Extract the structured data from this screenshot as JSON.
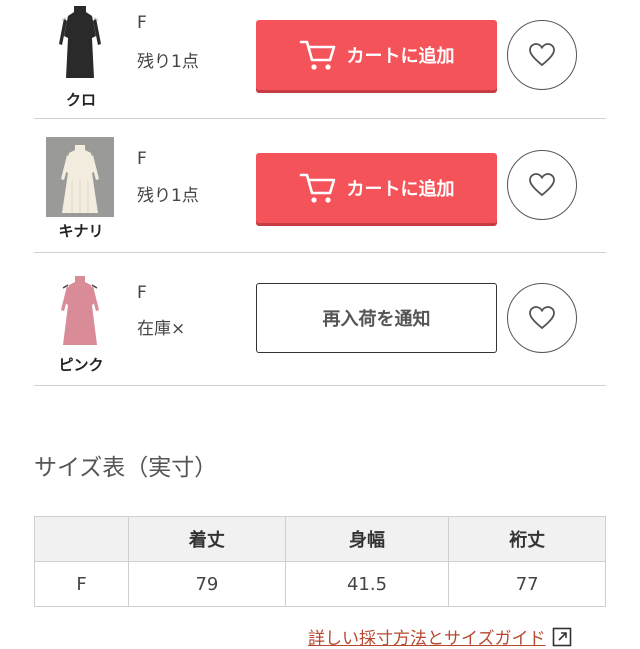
{
  "variants": [
    {
      "color": "クロ",
      "size": "F",
      "stock": "残り1点",
      "action_label": "カートに追加",
      "action_type": "cart",
      "dress_color": "#2a2a2a",
      "thumb_bg": "#ffffff"
    },
    {
      "color": "キナリ",
      "size": "F",
      "stock": "残り1点",
      "action_label": "カートに追加",
      "action_type": "cart",
      "dress_color": "#f3ede0",
      "thumb_bg": "#9a9a98"
    },
    {
      "color": "ピンク",
      "size": "F",
      "stock": "在庫×",
      "action_label": "再入荷を通知",
      "action_type": "notify",
      "dress_color": "#d98b98",
      "thumb_bg": "#ffffff"
    }
  ],
  "size_chart": {
    "title": "サイズ表（実寸）",
    "headers": [
      "",
      "着丈",
      "身幅",
      "裄丈"
    ],
    "rows": [
      [
        "F",
        "79",
        "41.5",
        "77"
      ]
    ]
  },
  "guide_link": {
    "label": "詳しい採寸方法とサイズガイド",
    "icon": "external-link-icon"
  },
  "colors": {
    "cart_button": "#f4535a",
    "link": "#b5482f"
  }
}
